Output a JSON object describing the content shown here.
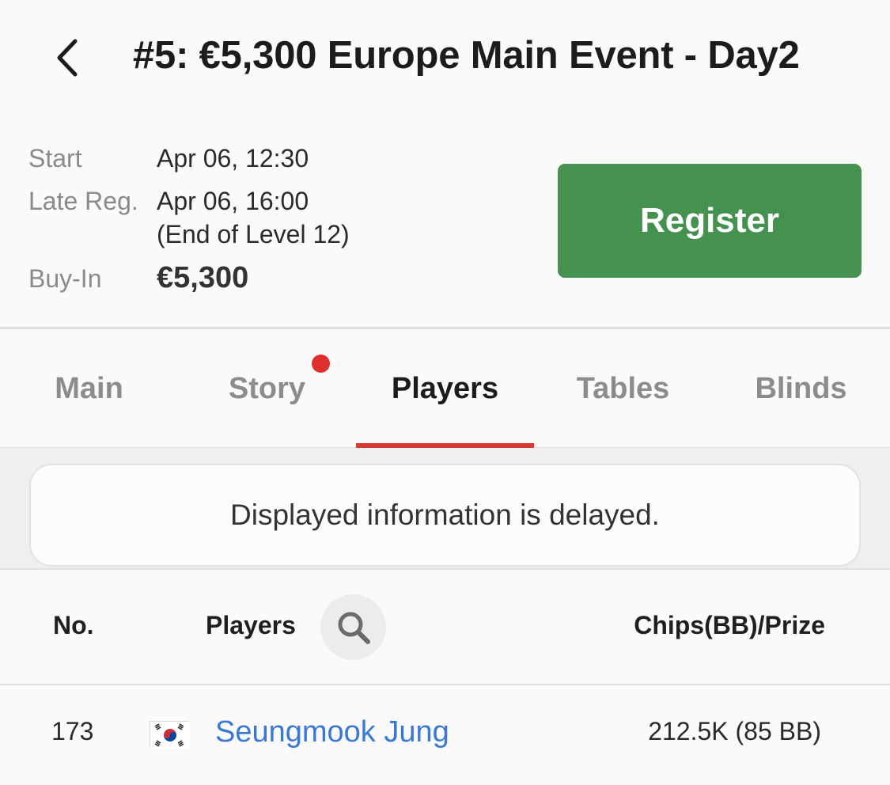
{
  "header": {
    "title": "#5: €5,300 Europe Main Event - Day2",
    "back_icon": "chevron-left-icon"
  },
  "info": {
    "start_label": "Start",
    "start_value": "Apr 06, 12:30",
    "late_reg_label": "Late Reg.",
    "late_reg_value": "Apr 06, 16:00",
    "late_reg_note": "(End of Level 12)",
    "buyin_label": "Buy-In",
    "buyin_value": "€5,300"
  },
  "register_button": {
    "label": "Register",
    "color": "#45914f"
  },
  "tabs": [
    {
      "label": "Main",
      "active": false,
      "has_dot": false
    },
    {
      "label": "Story",
      "active": false,
      "has_dot": true
    },
    {
      "label": "Players",
      "active": true,
      "has_dot": false
    },
    {
      "label": "Tables",
      "active": false,
      "has_dot": false
    },
    {
      "label": "Blinds",
      "active": false,
      "has_dot": false
    }
  ],
  "accent_color": "#d93a36",
  "notice": "Displayed information is delayed.",
  "table": {
    "columns": {
      "no": "No.",
      "players": "Players",
      "chips": "Chips(BB)/Prize"
    },
    "search_icon": "search-icon",
    "rows": [
      {
        "no": "173",
        "flag": "south-korea-flag-icon",
        "name": "Seungmook Jung",
        "chips": "212.5K (85 BB)"
      }
    ]
  }
}
